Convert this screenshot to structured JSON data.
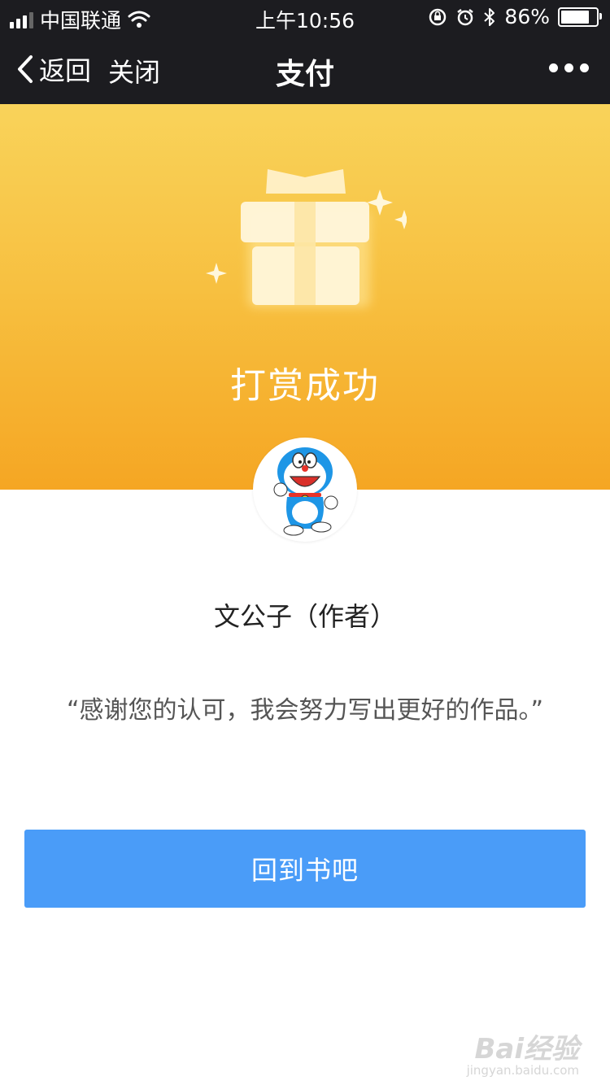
{
  "status_bar": {
    "carrier": "中国联通",
    "time": "上午10:56",
    "battery": "86%",
    "battery_level": 0.86
  },
  "nav": {
    "back_label": "返回",
    "close_label": "关闭",
    "title": "支付"
  },
  "hero": {
    "title": "打赏成功"
  },
  "author": {
    "name": "文公子（作者）"
  },
  "message": "“感谢您的认可，我会努力写出更好的作品。”",
  "button_label": "回到书吧",
  "watermark": {
    "line1": "Bai经验",
    "line2": "jingyan.baidu.com"
  },
  "colors": {
    "topbar": "#1c1c20",
    "hero_top": "#f9d35a",
    "hero_bottom": "#f5a623",
    "button": "#4a9cf8"
  }
}
